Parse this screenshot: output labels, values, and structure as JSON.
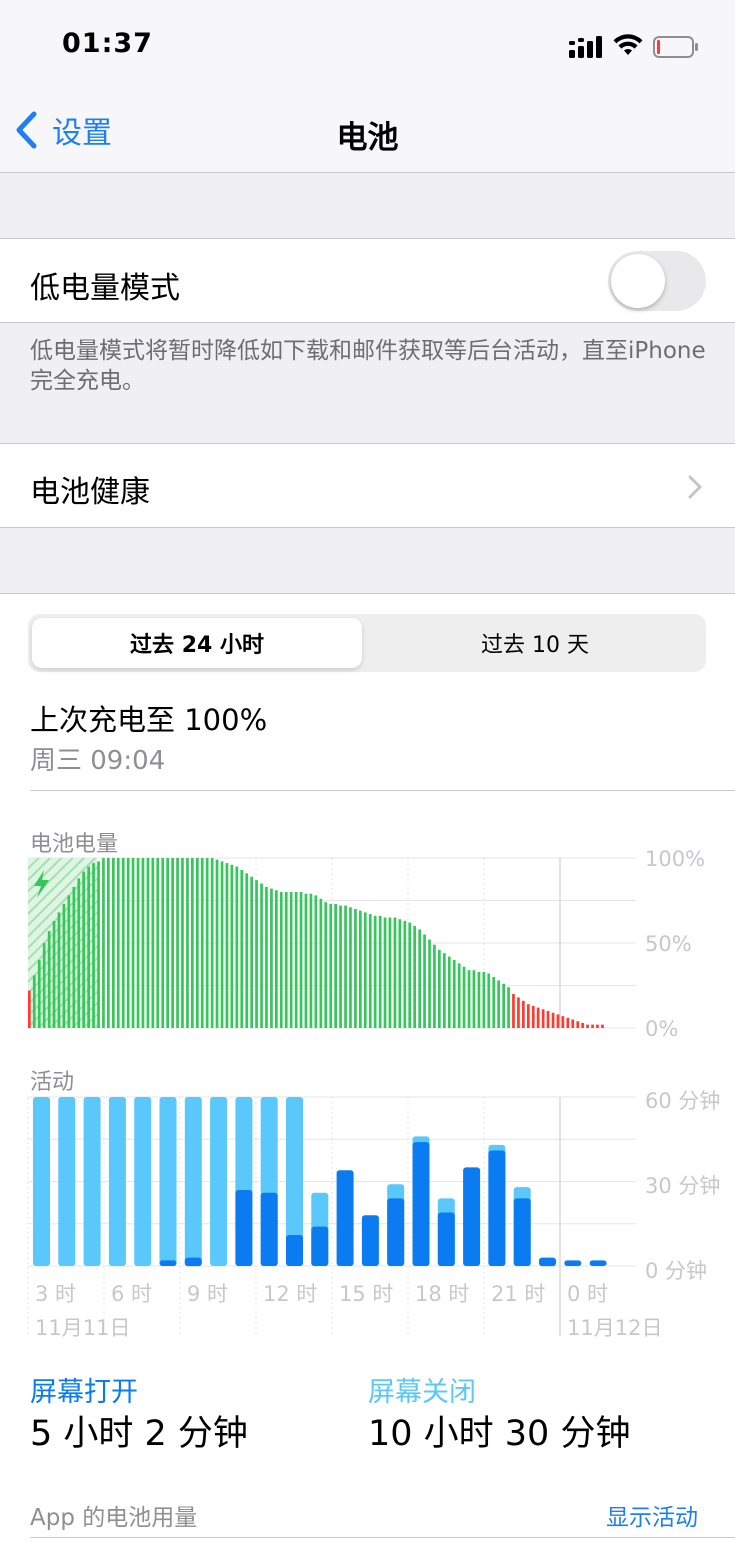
{
  "status_bar": {
    "time": "01:37"
  },
  "nav": {
    "back_label": "设置",
    "title": "电池"
  },
  "low_power": {
    "label": "低电量模式",
    "on": false,
    "description": "低电量模式将暂时降低如下载和邮件获取等后台活动，直至iPhone完全充电。"
  },
  "battery_health": {
    "label": "电池健康"
  },
  "segments": {
    "active": "过去 24 小时",
    "inactive": "过去 10 天"
  },
  "last_charge": {
    "title": "上次充电至 100%",
    "when": "周三 09:04"
  },
  "colors": {
    "accent": "#1e7ff0",
    "battery_green": "#34c759",
    "battery_low_red": "#ff3b30",
    "screen_on": "#0a7bf0",
    "screen_off": "#5ac8fa"
  },
  "chart_data": [
    {
      "type": "bar",
      "title": "电池电量",
      "y_ticks": [
        "100%",
        "50%",
        "0%"
      ],
      "ylim": [
        0,
        100
      ],
      "values": [
        22,
        31,
        40,
        50,
        57,
        63,
        68,
        73,
        78,
        83,
        88,
        92,
        95,
        97,
        98,
        100,
        100,
        100,
        100,
        100,
        100,
        100,
        100,
        100,
        100,
        100,
        100,
        100,
        100,
        100,
        100,
        100,
        100,
        100,
        100,
        100,
        100,
        100,
        99,
        98,
        97,
        96,
        95,
        93,
        91,
        89,
        87,
        85,
        83,
        82,
        81,
        80,
        80,
        80,
        80,
        80,
        79,
        79,
        78,
        76,
        74,
        73,
        73,
        72,
        72,
        71,
        70,
        69,
        68,
        67,
        66,
        66,
        65,
        65,
        65,
        64,
        63,
        62,
        60,
        58,
        55,
        52,
        49,
        46,
        44,
        42,
        40,
        38,
        36,
        34,
        34,
        33,
        33,
        32,
        30,
        28,
        26,
        24,
        20,
        18,
        16,
        14,
        13,
        12,
        11,
        10,
        9,
        8,
        7,
        6,
        5,
        4,
        3,
        2,
        2,
        2,
        2
      ],
      "charging_until_index": 12,
      "low_threshold": 20
    },
    {
      "type": "bar",
      "title": "活动",
      "y_ticks": [
        "60 分钟",
        "30 分钟",
        "0 分钟"
      ],
      "ylim": [
        0,
        60
      ],
      "x_tick_labels": [
        "3 时",
        "6 时",
        "9 时",
        "12 时",
        "15 时",
        "18 时",
        "21 时",
        "0 时"
      ],
      "date_labels": [
        "11月11日",
        "11月12日"
      ],
      "series": [
        {
          "name": "屏幕打开",
          "values": [
            0,
            0,
            0,
            0,
            0,
            2,
            3,
            0,
            27,
            26,
            11,
            14,
            34,
            18,
            24,
            44,
            19,
            35,
            41,
            24,
            3,
            2,
            2
          ]
        },
        {
          "name": "屏幕关闭",
          "values": [
            60,
            60,
            60,
            60,
            60,
            58,
            57,
            60,
            33,
            34,
            49,
            12,
            0,
            0,
            5,
            2,
            5,
            0,
            2,
            4,
            0,
            0,
            0
          ]
        }
      ]
    }
  ],
  "screen_stats": {
    "on_label": "屏幕打开",
    "on_value": "5 小时 2 分钟",
    "off_label": "屏幕关闭",
    "off_value": "10 小时 30 分钟"
  },
  "app_usage": {
    "label": "App 的电池用量",
    "action": "显示活动"
  }
}
